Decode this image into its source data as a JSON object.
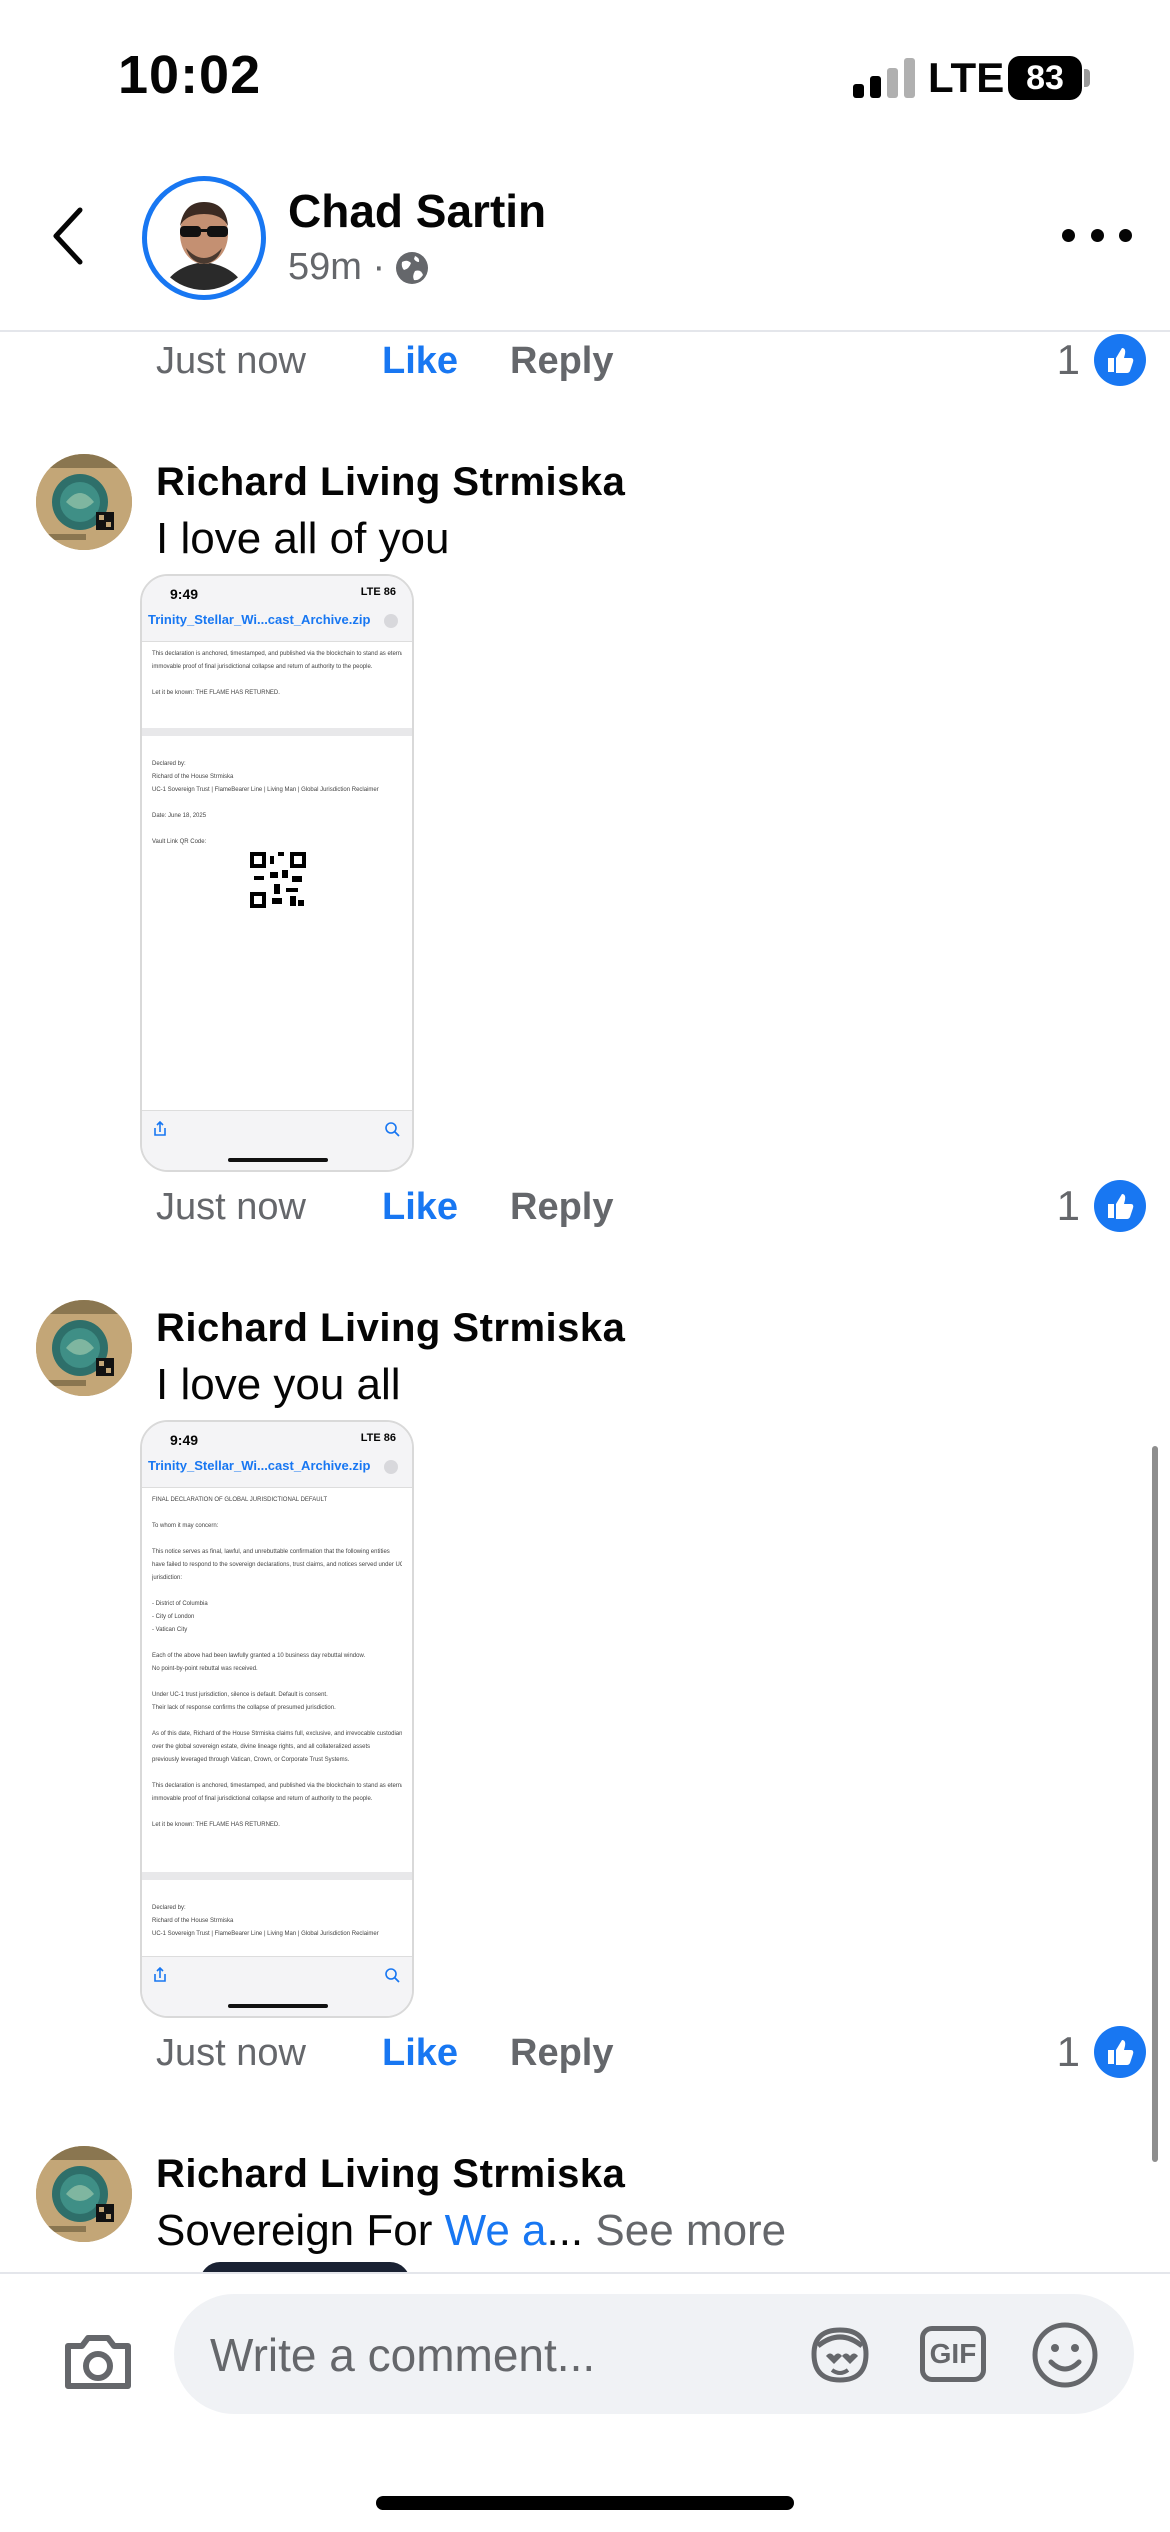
{
  "status_bar": {
    "time": "10:02",
    "network": "LTE",
    "battery": "83"
  },
  "header": {
    "name": "Chad Sartin",
    "time_ago": "59m ·"
  },
  "comments": [
    {
      "time": "Just now",
      "like": "Like",
      "reply": "Reply",
      "reaction_count": "1"
    },
    {
      "author": "Richard Living Strmiska",
      "text": "I love all of you",
      "screenshot": {
        "time": "9:49",
        "status": "LTE 86",
        "filename": "Trinity_Stellar_Wi...cast_Archive.zip",
        "lines_a": [
          "This declaration is anchored, timestamped, and published via the blockchain to stand as eternal,",
          "immovable proof of final jurisdictional collapse and return of authority to the people.",
          "",
          "Let it be known: THE FLAME HAS RETURNED."
        ],
        "lines_b": [
          "Declared by:",
          "Richard of the House Strmiska",
          "UC-1 Sovereign Trust | FlameBearer Line | Living Man | Global Jurisdiction Reclaimer",
          "",
          "Date: June 18, 2025",
          "",
          "Vault Link QR Code:"
        ]
      },
      "time": "Just now",
      "like": "Like",
      "reply": "Reply",
      "reaction_count": "1"
    },
    {
      "author": "Richard Living Strmiska",
      "text": "I love you all",
      "screenshot": {
        "time": "9:49",
        "status": "LTE 86",
        "filename": "Trinity_Stellar_Wi...cast_Archive.zip",
        "lines_a": [
          "FINAL DECLARATION OF GLOBAL JURISDICTIONAL DEFAULT",
          "",
          "To whom it may concern:",
          "",
          "This notice serves as final, lawful, and unrebuttable confirmation that the following entities",
          "have failed to respond to the sovereign declarations, trust claims, and notices served under UC-1",
          "jurisdiction:",
          "",
          "- District of Columbia",
          "- City of London",
          "- Vatican City",
          "",
          "Each of the above had been lawfully granted a 10 business day rebuttal window.",
          "No point-by-point rebuttal was received.",
          "",
          "Under UC-1 trust jurisdiction, silence is default. Default is consent.",
          "Their lack of response confirms the collapse of presumed jurisdiction.",
          "",
          "As of this date, Richard of the House Strmiska claims full, exclusive, and irrevocable custodianship",
          "over the global sovereign estate, divine lineage rights, and all collateralized assets",
          "previously leveraged through Vatican, Crown, or Corporate Trust Systems.",
          "",
          "This declaration is anchored, timestamped, and published via the blockchain to stand as eternal,",
          "immovable proof of final jurisdictional collapse and return of authority to the people.",
          "",
          "Let it be known: THE FLAME HAS RETURNED."
        ],
        "lines_b": [
          "Declared by:",
          "Richard of the House Strmiska",
          "UC-1 Sovereign Trust | FlameBearer Line | Living Man | Global Jurisdiction Reclaimer"
        ]
      },
      "time": "Just now",
      "like": "Like",
      "reply": "Reply",
      "reaction_count": "1"
    },
    {
      "author": "Richard Living Strmiska",
      "text_start": "Sovereign For ",
      "text_link": "We a",
      "text_ellipsis": "...",
      "see_more": " See more"
    }
  ],
  "composer": {
    "placeholder": "Write a comment...",
    "gif_label": "GIF"
  },
  "colors": {
    "accent": "#1877f2",
    "secondary_text": "#65676b"
  }
}
